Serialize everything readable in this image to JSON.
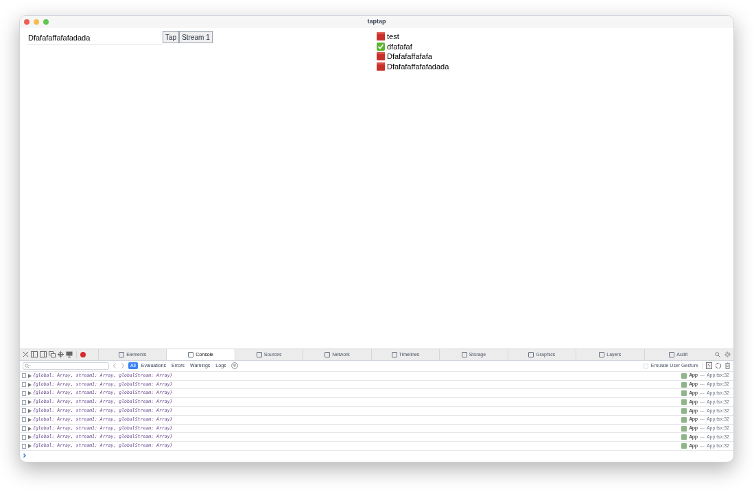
{
  "window": {
    "title": "taptap"
  },
  "app": {
    "input": {
      "value": "Dfafafaffafafadada"
    },
    "buttons": [
      "Tap",
      "Stream 1"
    ],
    "todos": [
      {
        "text": "test",
        "done": false
      },
      {
        "text": "dfafafaf",
        "done": true
      },
      {
        "text": "Dfafafaffafafa",
        "done": false
      },
      {
        "text": "Dfafafaffafafadada",
        "done": false
      }
    ]
  },
  "devtools": {
    "tabs": [
      {
        "label": "Elements",
        "selected": false
      },
      {
        "label": "Console",
        "selected": true
      },
      {
        "label": "Sources",
        "selected": false
      },
      {
        "label": "Network",
        "selected": false
      },
      {
        "label": "Timelines",
        "selected": false
      },
      {
        "label": "Storage",
        "selected": false
      },
      {
        "label": "Graphics",
        "selected": false
      },
      {
        "label": "Layers",
        "selected": false
      },
      {
        "label": "Audit",
        "selected": false
      }
    ],
    "filters": [
      {
        "label": "All",
        "selected": true
      },
      {
        "label": "Evaluations",
        "selected": false
      },
      {
        "label": "Errors",
        "selected": false
      },
      {
        "label": "Warnings",
        "selected": false
      },
      {
        "label": "Logs",
        "selected": false
      }
    ],
    "emulate_gesture": {
      "label": "Emulate User Gesture",
      "checked": false
    },
    "messages": [
      {
        "text": "{global: Array, stream1: Array, globalStream: Array}",
        "function": "App",
        "separator": "—",
        "location": "App.tsx:32"
      },
      {
        "text": "{global: Array, stream1: Array, globalStream: Array}",
        "function": "App",
        "separator": "—",
        "location": "App.tsx:32"
      },
      {
        "text": "{global: Array, stream1: Array, globalStream: Array}",
        "function": "App",
        "separator": "—",
        "location": "App.tsx:32"
      },
      {
        "text": "{global: Array, stream1: Array, globalStream: Array}",
        "function": "App",
        "separator": "—",
        "location": "App.tsx:32"
      },
      {
        "text": "{global: Array, stream1: Array, globalStream: Array}",
        "function": "App",
        "separator": "—",
        "location": "App.tsx:32"
      },
      {
        "text": "{global: Array, stream1: Array, globalStream: Array}",
        "function": "App",
        "separator": "—",
        "location": "App.tsx:32"
      },
      {
        "text": "{global: Array, stream1: Array, globalStream: Array}",
        "function": "App",
        "separator": "—",
        "location": "App.tsx:32"
      },
      {
        "text": "{global: Array, stream1: Array, globalStream: Array}",
        "function": "App",
        "separator": "—",
        "location": "App.tsx:32"
      },
      {
        "text": "{global: Array, stream1: Array, globalStream: Array}",
        "function": "App",
        "separator": "—",
        "location": "App.tsx:32"
      }
    ]
  }
}
